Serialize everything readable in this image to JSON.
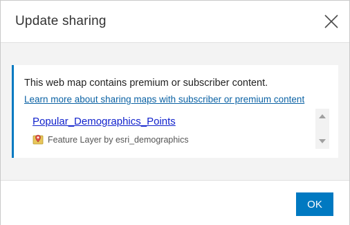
{
  "dialog": {
    "title": "Update sharing",
    "close_icon": "close-icon"
  },
  "notice": {
    "message": "This web map contains premium or subscriber content.",
    "link_text": "Learn more about sharing maps with subscriber or premium content",
    "accent_color": "#0079c1"
  },
  "items": [
    {
      "title": "Popular_Demographics_Points",
      "meta": "Feature Layer by esri_demographics",
      "icon": "feature-layer-premium-icon"
    }
  ],
  "footer": {
    "ok_label": "OK",
    "ok_color": "#0079c1"
  }
}
